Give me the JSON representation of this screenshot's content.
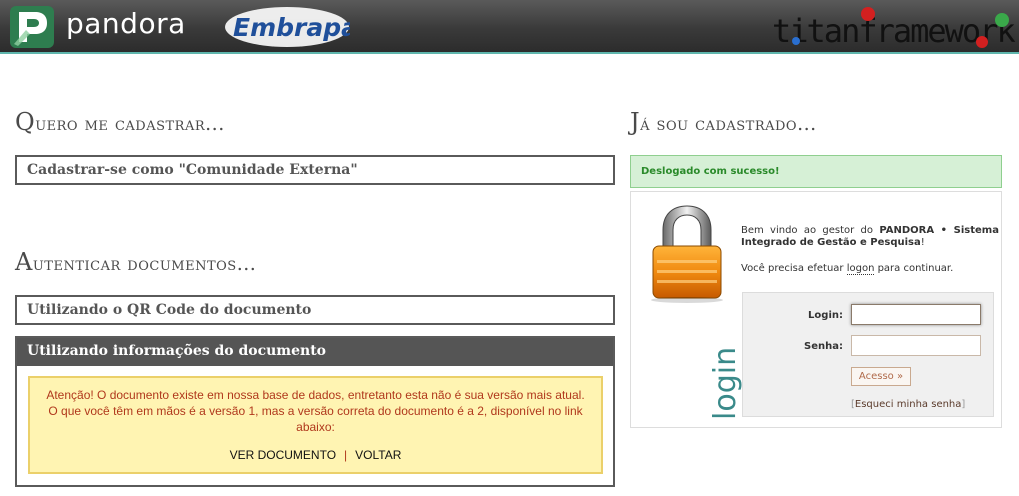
{
  "header": {
    "app_name": "pandora",
    "partner_logo_text": "Embrapa",
    "framework_logo_text": "titanframework"
  },
  "register": {
    "title_first": "Q",
    "title_rest": "uero me cadastrar...",
    "external_community_link": "Cadastrar-se como \"Comunidade Externa\""
  },
  "authenticate": {
    "title_first": "A",
    "title_rest": "utenticar documentos...",
    "qr_code_link": "Utilizando o QR Code do documento",
    "info_panel_title": "Utilizando informações do documento",
    "alert_message": "Atenção! O documento existe em nossa base de dados, entretanto esta não é sua versão mais atual. O que você têm em mãos é a versão 1, mas a versão correta do documento é a 2, disponível no link abaixo:",
    "view_document_link": "VER DOCUMENTO",
    "separator": "|",
    "back_link": "VOLTAR"
  },
  "login": {
    "title_first": "J",
    "title_rest": "á sou cadastrado...",
    "success_message": "Deslogado com sucesso!",
    "welcome_prefix": "Bem vindo ao gestor do ",
    "system_name": "PANDORA • Sistema Integrado de Gestão e Pesquisa",
    "welcome_suffix": "!",
    "need_prefix": "Você precisa efetuar ",
    "need_logon": "logon",
    "need_suffix": " para continuar.",
    "side_label": "login",
    "login_label": "Login:",
    "login_value": "",
    "password_label": "Senha:",
    "password_value": "",
    "access_button": "Acesso »",
    "forgot_open": "[",
    "forgot_link": "Esqueci minha senha",
    "forgot_close": "]"
  },
  "colors": {
    "header_accent": "#5fb6ad",
    "alert_bg": "#fff4b2",
    "alert_text": "#b0381c",
    "success_bg": "#d6f0d6",
    "success_text": "#2a8a2a",
    "login_word": "#3a8a8a"
  },
  "icons": [
    "pandora-p-icon",
    "embrapa-logo",
    "titan-framework-logo",
    "padlock-icon"
  ]
}
